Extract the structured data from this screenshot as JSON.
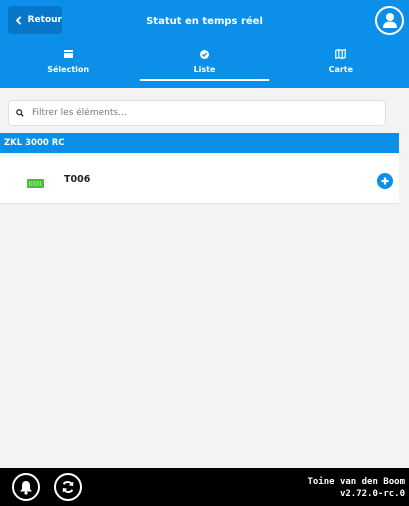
{
  "colors": {
    "header": "#0b8fe8",
    "back_button": "#0877c9",
    "footer": "#000000",
    "device_icon": "#4cbb3a"
  },
  "header": {
    "back_label": "Retour",
    "title": "Statut en temps réel",
    "tabs": [
      {
        "label": "Sélection",
        "icon": "rectangle-icon",
        "active": false
      },
      {
        "label": "Liste",
        "icon": "check-circle-icon",
        "active": true
      },
      {
        "label": "Carte",
        "icon": "map-icon",
        "active": false
      }
    ]
  },
  "search": {
    "placeholder": "Filtrer les éléments..."
  },
  "groups": [
    {
      "name": "ZKL 3000 RC",
      "items": [
        {
          "label": "T006",
          "icon": "battery-device-icon"
        }
      ]
    }
  ],
  "footer": {
    "user_name": "Toine van den Boom",
    "version": "v2.72.0-rc.0"
  }
}
